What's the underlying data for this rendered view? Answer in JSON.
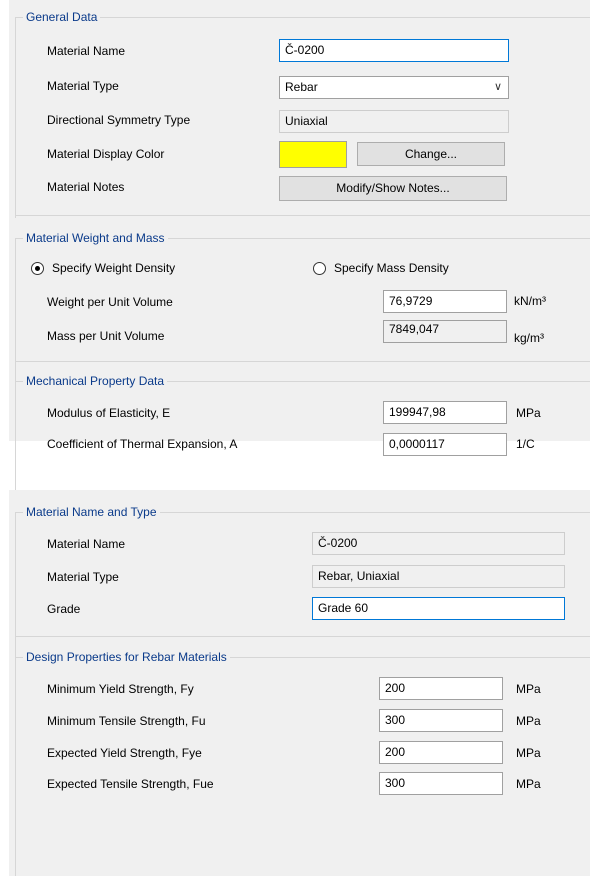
{
  "general": {
    "legend": "General Data",
    "material_name_label": "Material Name",
    "material_name_value": "Č-0200",
    "material_type_label": "Material Type",
    "material_type_value": "Rebar",
    "symmetry_label": "Directional Symmetry Type",
    "symmetry_value": "Uniaxial",
    "display_color_label": "Material Display Color",
    "display_color": "#ffff00",
    "change_button": "Change...",
    "notes_label": "Material Notes",
    "notes_button": "Modify/Show Notes..."
  },
  "weight": {
    "legend": "Material Weight and Mass",
    "radio_weight": "Specify Weight Density",
    "radio_mass": "Specify Mass Density",
    "selected": "weight",
    "weight_label": "Weight per Unit Volume",
    "weight_value": "76,9729",
    "weight_unit": "kN/m³",
    "mass_label": "Mass per Unit Volume",
    "mass_value": "7849,047",
    "mass_unit": "kg/m³"
  },
  "mechanical": {
    "legend": "Mechanical Property Data",
    "modulus_label": "Modulus of Elasticity,  E",
    "modulus_value": "199947,98",
    "modulus_unit": "MPa",
    "thermal_label": "Coefficient of Thermal Expansion,  A",
    "thermal_value": "0,0000117",
    "thermal_unit": "1/C"
  },
  "nametype": {
    "legend": "Material Name and Type",
    "material_name_label": "Material Name",
    "material_name_value": "Č-0200",
    "material_type_label": "Material Type",
    "material_type_value": "Rebar, Uniaxial",
    "grade_label": "Grade",
    "grade_value": "Grade 60"
  },
  "design": {
    "legend": "Design Properties for Rebar Materials",
    "rows": [
      {
        "label": "Minimum Yield Strength, Fy",
        "value": "200",
        "unit": "MPa"
      },
      {
        "label": "Minimum Tensile Strength, Fu",
        "value": "300",
        "unit": "MPa"
      },
      {
        "label": "Expected Yield Strength, Fye",
        "value": "200",
        "unit": "MPa"
      },
      {
        "label": "Expected Tensile Strength, Fue",
        "value": "300",
        "unit": "MPa"
      }
    ]
  }
}
